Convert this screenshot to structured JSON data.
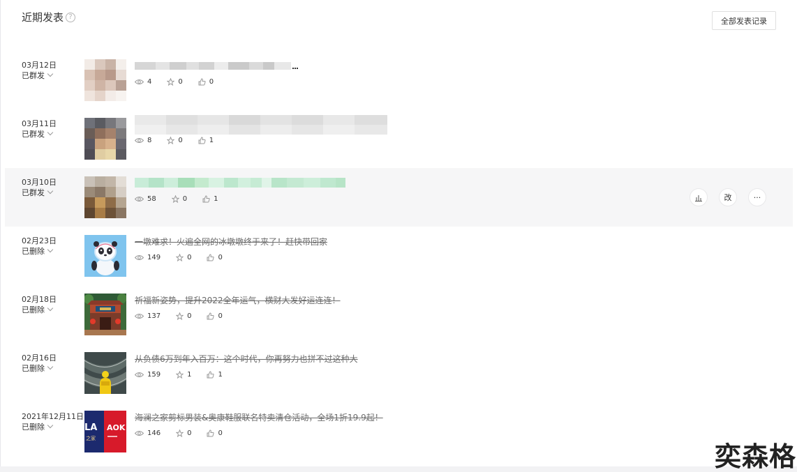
{
  "header": {
    "title": "近期发表",
    "help_glyph": "?",
    "all_records_label": "全部发表记录"
  },
  "posts": [
    {
      "date": "03月12日",
      "status": "已群发",
      "title": "",
      "views": "4",
      "shares": "0",
      "likes": "0",
      "deleted": false,
      "title_redacted": true
    },
    {
      "date": "03月11日",
      "status": "已群发",
      "title": "",
      "views": "8",
      "shares": "0",
      "likes": "1",
      "deleted": false,
      "title_redacted": true
    },
    {
      "date": "03月10日",
      "status": "已群发",
      "title": "",
      "views": "58",
      "shares": "0",
      "likes": "1",
      "deleted": false,
      "title_redacted": true,
      "highlighted": true
    },
    {
      "date": "02月23日",
      "status": "已删除",
      "title": "一墩难求！火遍全网的冰墩墩终于来了！赶快带回家",
      "views": "149",
      "shares": "0",
      "likes": "0",
      "deleted": true
    },
    {
      "date": "02月18日",
      "status": "已删除",
      "title": "祈福新姿势，提升2022全年运气，横财大发好运连连！",
      "views": "137",
      "shares": "0",
      "likes": "0",
      "deleted": true
    },
    {
      "date": "02月16日",
      "status": "已删除",
      "title": "从负债6万到年入百万：这个时代，你再努力也拼不过这种大",
      "views": "159",
      "shares": "1",
      "likes": "1",
      "deleted": true
    },
    {
      "date": "2021年12月11日",
      "status": "已删除",
      "title": "海澜之家剪标男装&奥康鞋服联名特卖清仓活动，全场1折19.9起！",
      "views": "146",
      "shares": "0",
      "likes": "0",
      "deleted": true
    }
  ],
  "row_actions": {
    "stats_glyph": "bar-chart-icon",
    "edit_label": "改",
    "more_glyph": "···"
  },
  "thumb_text": {
    "ad_left": "LA",
    "ad_left_sub": "之家",
    "ad_right": "AOK"
  },
  "watermark": "奕森格",
  "colors": {
    "highlight_row": "#f6f6f7",
    "redacted_green": "#b8e6cc",
    "text": "#353535"
  }
}
